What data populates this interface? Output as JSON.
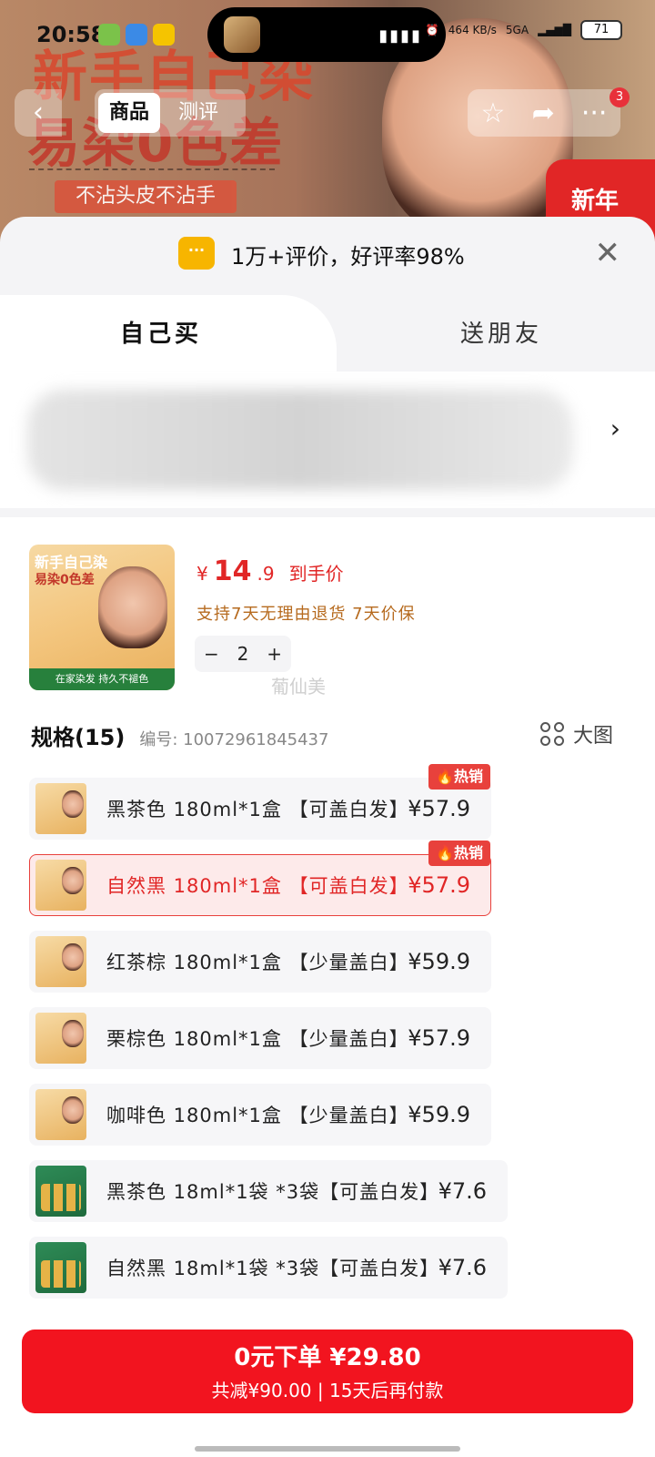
{
  "status_bar": {
    "time": "20:58",
    "net_speed": "464\nKB/s",
    "signal": "5GA",
    "battery": "71"
  },
  "hero": {
    "line1": "新手自己染",
    "line2": "易染0色差",
    "badge": "不沾头皮不沾手",
    "corner": "新年"
  },
  "nav": {
    "back_icon": "chevron-left-icon",
    "tabs": [
      "商品",
      "测评"
    ],
    "message_badge": "3"
  },
  "rating": {
    "text": "1万+评价，好评率98%",
    "icon_text": "···"
  },
  "mode_tabs": [
    "自己买",
    "送朋友"
  ],
  "product": {
    "thumb_line1": "新手自己染",
    "thumb_line2": "易染0色差",
    "thumb_footer": "在家染发 持久不褪色",
    "price_currency": "¥",
    "price_int": "14",
    "price_dec": ".9",
    "price_label": "到手价",
    "service": "支持7天无理由退货  7天价保",
    "quantity": "2",
    "minus": "−",
    "plus": "+",
    "watermark": "葡仙美"
  },
  "spec": {
    "title": "规格(15)",
    "code": "编号: 10072961845437",
    "big_image_label": "大图",
    "hot_label": "热销",
    "items": [
      {
        "name": "黑茶色 180ml*1盒 【可盖白发】",
        "price": "¥57.9",
        "hot": true,
        "selected": false,
        "kind": "box"
      },
      {
        "name": "自然黑 180ml*1盒 【可盖白发】",
        "price": "¥57.9",
        "hot": true,
        "selected": true,
        "kind": "box"
      },
      {
        "name": "红茶棕 180ml*1盒 【少量盖白】",
        "price": "¥59.9",
        "hot": false,
        "selected": false,
        "kind": "box"
      },
      {
        "name": "栗棕色 180ml*1盒 【少量盖白】",
        "price": "¥57.9",
        "hot": false,
        "selected": false,
        "kind": "box"
      },
      {
        "name": "咖啡色 180ml*1盒 【少量盖白】",
        "price": "¥59.9",
        "hot": false,
        "selected": false,
        "kind": "box"
      },
      {
        "name": "黑茶色 18ml*1袋 *3袋【可盖白发】",
        "price": "¥7.6",
        "hot": false,
        "selected": false,
        "kind": "sachet"
      },
      {
        "name": "自然黑 18ml*1袋 *3袋【可盖白发】",
        "price": "¥7.6",
        "hot": false,
        "selected": false,
        "kind": "sachet"
      }
    ]
  },
  "order": {
    "main": "0元下单 ¥29.80",
    "sub": "共减¥90.00 | 15天后再付款"
  },
  "colors": {
    "accent_red": "#f2141f",
    "price_red": "#e12626",
    "service_orange": "#b66a1e"
  }
}
